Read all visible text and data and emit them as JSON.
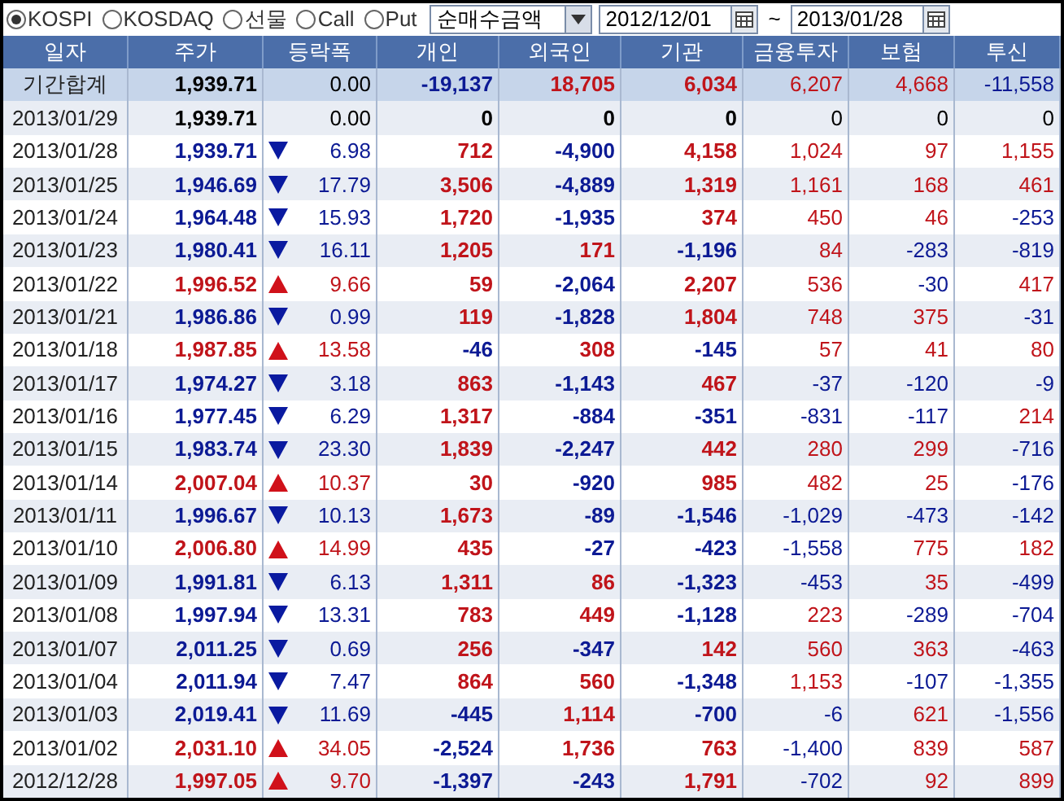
{
  "market_options": [
    {
      "label": "KOSPI",
      "selected": true
    },
    {
      "label": "KOSDAQ",
      "selected": false
    },
    {
      "label": "선물",
      "selected": false
    },
    {
      "label": "Call",
      "selected": false
    },
    {
      "label": "Put",
      "selected": false
    }
  ],
  "metric_dropdown": {
    "value": "순매수금액"
  },
  "date_from": {
    "value": "2012/12/01"
  },
  "date_separator": "~",
  "date_to": {
    "value": "2013/01/28"
  },
  "table": {
    "columns": [
      "일자",
      "주가",
      "등락폭",
      "개인",
      "외국인",
      "기관",
      "금융투자",
      "보험",
      "투신"
    ],
    "rows": [
      {
        "kind": "total",
        "date": "기간합계",
        "price": "1,939.71",
        "rising": false,
        "falling": false,
        "change": "0.00",
        "values": [
          "-19,137",
          "18,705",
          "6,034",
          "6,207",
          "4,668",
          "-11,558"
        ]
      },
      {
        "kind": "day",
        "date": "2013/01/29",
        "price": "1,939.71",
        "rising": false,
        "falling": false,
        "change": "0.00",
        "values": [
          "0",
          "0",
          "0",
          "0",
          "0",
          "0"
        ]
      },
      {
        "kind": "day",
        "date": "2013/01/28",
        "price": "1,939.71",
        "rising": false,
        "falling": true,
        "change": "6.98",
        "values": [
          "712",
          "-4,900",
          "4,158",
          "1,024",
          "97",
          "1,155"
        ]
      },
      {
        "kind": "day",
        "date": "2013/01/25",
        "price": "1,946.69",
        "rising": false,
        "falling": true,
        "change": "17.79",
        "values": [
          "3,506",
          "-4,889",
          "1,319",
          "1,161",
          "168",
          "461"
        ]
      },
      {
        "kind": "day",
        "date": "2013/01/24",
        "price": "1,964.48",
        "rising": false,
        "falling": true,
        "change": "15.93",
        "values": [
          "1,720",
          "-1,935",
          "374",
          "450",
          "46",
          "-253"
        ]
      },
      {
        "kind": "day",
        "date": "2013/01/23",
        "price": "1,980.41",
        "rising": false,
        "falling": true,
        "change": "16.11",
        "values": [
          "1,205",
          "171",
          "-1,196",
          "84",
          "-283",
          "-819"
        ]
      },
      {
        "kind": "day",
        "date": "2013/01/22",
        "price": "1,996.52",
        "rising": true,
        "falling": false,
        "change": "9.66",
        "values": [
          "59",
          "-2,064",
          "2,207",
          "536",
          "-30",
          "417"
        ]
      },
      {
        "kind": "day",
        "date": "2013/01/21",
        "price": "1,986.86",
        "rising": false,
        "falling": true,
        "change": "0.99",
        "values": [
          "119",
          "-1,828",
          "1,804",
          "748",
          "375",
          "-31"
        ]
      },
      {
        "kind": "day",
        "date": "2013/01/18",
        "price": "1,987.85",
        "rising": true,
        "falling": false,
        "change": "13.58",
        "values": [
          "-46",
          "308",
          "-145",
          "57",
          "41",
          "80"
        ]
      },
      {
        "kind": "day",
        "date": "2013/01/17",
        "price": "1,974.27",
        "rising": false,
        "falling": true,
        "change": "3.18",
        "values": [
          "863",
          "-1,143",
          "467",
          "-37",
          "-120",
          "-9"
        ]
      },
      {
        "kind": "day",
        "date": "2013/01/16",
        "price": "1,977.45",
        "rising": false,
        "falling": true,
        "change": "6.29",
        "values": [
          "1,317",
          "-884",
          "-351",
          "-831",
          "-117",
          "214"
        ]
      },
      {
        "kind": "day",
        "date": "2013/01/15",
        "price": "1,983.74",
        "rising": false,
        "falling": true,
        "change": "23.30",
        "values": [
          "1,839",
          "-2,247",
          "442",
          "280",
          "299",
          "-716"
        ]
      },
      {
        "kind": "day",
        "date": "2013/01/14",
        "price": "2,007.04",
        "rising": true,
        "falling": false,
        "change": "10.37",
        "values": [
          "30",
          "-920",
          "985",
          "482",
          "25",
          "-176"
        ]
      },
      {
        "kind": "day",
        "date": "2013/01/11",
        "price": "1,996.67",
        "rising": false,
        "falling": true,
        "change": "10.13",
        "values": [
          "1,673",
          "-89",
          "-1,546",
          "-1,029",
          "-473",
          "-142"
        ]
      },
      {
        "kind": "day",
        "date": "2013/01/10",
        "price": "2,006.80",
        "rising": true,
        "falling": false,
        "change": "14.99",
        "values": [
          "435",
          "-27",
          "-423",
          "-1,558",
          "775",
          "182"
        ]
      },
      {
        "kind": "day",
        "date": "2013/01/09",
        "price": "1,991.81",
        "rising": false,
        "falling": true,
        "change": "6.13",
        "values": [
          "1,311",
          "86",
          "-1,323",
          "-453",
          "35",
          "-499"
        ]
      },
      {
        "kind": "day",
        "date": "2013/01/08",
        "price": "1,997.94",
        "rising": false,
        "falling": true,
        "change": "13.31",
        "values": [
          "783",
          "449",
          "-1,128",
          "223",
          "-289",
          "-704"
        ]
      },
      {
        "kind": "day",
        "date": "2013/01/07",
        "price": "2,011.25",
        "rising": false,
        "falling": true,
        "change": "0.69",
        "values": [
          "256",
          "-347",
          "142",
          "560",
          "363",
          "-463"
        ]
      },
      {
        "kind": "day",
        "date": "2013/01/04",
        "price": "2,011.94",
        "rising": false,
        "falling": true,
        "change": "7.47",
        "values": [
          "864",
          "560",
          "-1,348",
          "1,153",
          "-107",
          "-1,355"
        ]
      },
      {
        "kind": "day",
        "date": "2013/01/03",
        "price": "2,019.41",
        "rising": false,
        "falling": true,
        "change": "11.69",
        "values": [
          "-445",
          "1,114",
          "-700",
          "-6",
          "621",
          "-1,556"
        ]
      },
      {
        "kind": "day",
        "date": "2013/01/02",
        "price": "2,031.10",
        "rising": true,
        "falling": false,
        "change": "34.05",
        "values": [
          "-2,524",
          "1,736",
          "763",
          "-1,400",
          "839",
          "587"
        ]
      },
      {
        "kind": "day",
        "date": "2012/12/28",
        "price": "1,997.05",
        "rising": true,
        "falling": false,
        "change": "9.70",
        "values": [
          "-1,397",
          "-243",
          "1,791",
          "-702",
          "92",
          "899"
        ]
      }
    ]
  }
}
